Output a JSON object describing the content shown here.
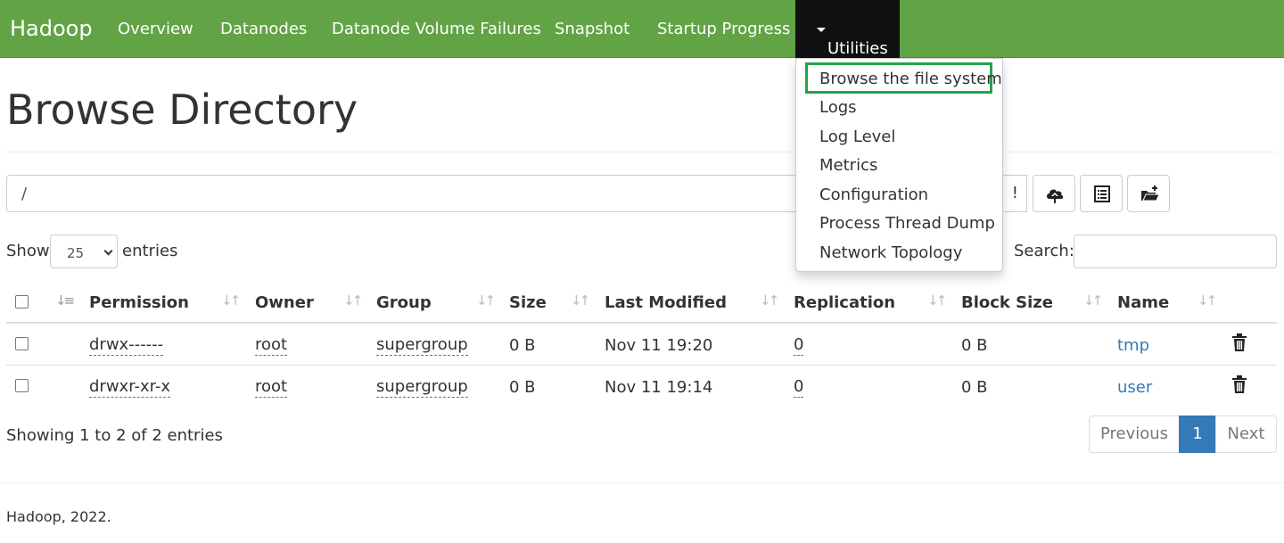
{
  "navbar": {
    "brand": "Hadoop",
    "items": [
      "Overview",
      "Datanodes",
      "Datanode Volume Failures",
      "Snapshot",
      "Startup Progress"
    ],
    "active": "Utilities"
  },
  "utilities_menu": {
    "items": [
      "Browse the file system",
      "Logs",
      "Log Level",
      "Metrics",
      "Configuration",
      "Process Thread Dump",
      "Network Topology"
    ],
    "highlighted": "Browse the file system"
  },
  "page": {
    "title": "Browse Directory",
    "path": "/",
    "go_label": "Go!"
  },
  "toolbar_icons": [
    "cloud-upload-icon",
    "list-alt-icon",
    "folder-open-icon"
  ],
  "entries": {
    "show_label": "Show",
    "value": "25",
    "suffix": "entries",
    "search_label": "Search:",
    "search_value": ""
  },
  "table": {
    "columns": [
      "Permission",
      "Owner",
      "Group",
      "Size",
      "Last Modified",
      "Replication",
      "Block Size",
      "Name"
    ],
    "rows": [
      {
        "permission": "drwx------",
        "owner": "root",
        "group": "supergroup",
        "size": "0 B",
        "last_modified": "Nov 11 19:20",
        "replication": "0",
        "block_size": "0 B",
        "name": "tmp"
      },
      {
        "permission": "drwxr-xr-x",
        "owner": "root",
        "group": "supergroup",
        "size": "0 B",
        "last_modified": "Nov 11 19:14",
        "replication": "0",
        "block_size": "0 B",
        "name": "user"
      }
    ]
  },
  "pagination": {
    "info": "Showing 1 to 2 of 2 entries",
    "previous": "Previous",
    "current": "1",
    "next": "Next"
  },
  "footer": {
    "text": "Hadoop, 2022."
  },
  "colors": {
    "navbar": "#62a346",
    "active_nav": "#101010",
    "link": "#337ab7",
    "highlight_border": "#22a34b"
  }
}
